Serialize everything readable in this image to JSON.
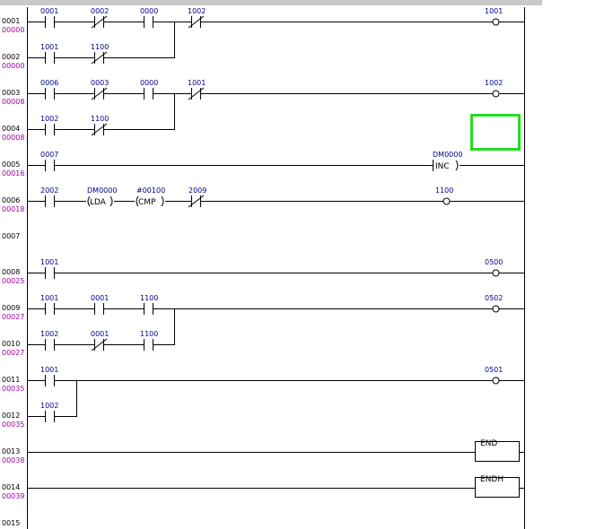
{
  "rungs": [
    {
      "num": "0001",
      "addr": "00000"
    },
    {
      "num": "0002",
      "addr": "00000"
    },
    {
      "num": "0003",
      "addr": "00008"
    },
    {
      "num": "0004",
      "addr": "00008"
    },
    {
      "num": "0005",
      "addr": "00016"
    },
    {
      "num": "0006",
      "addr": "00018"
    },
    {
      "num": "0007",
      "addr": ""
    },
    {
      "num": "0008",
      "addr": "00025"
    },
    {
      "num": "0009",
      "addr": "00027"
    },
    {
      "num": "0010",
      "addr": "00027"
    },
    {
      "num": "0011",
      "addr": "00035"
    },
    {
      "num": "0012",
      "addr": "00035"
    },
    {
      "num": "0013",
      "addr": "00038"
    },
    {
      "num": "0014",
      "addr": "00039"
    },
    {
      "num": "0015",
      "addr": ""
    }
  ],
  "elements": {
    "r1": {
      "c1": "0001",
      "c2": "0002",
      "c3": "0000",
      "c4": "1002",
      "coil": "1001"
    },
    "r2": {
      "c1": "1001",
      "c2": "1100"
    },
    "r3": {
      "c1": "0006",
      "c2": "0003",
      "c3": "0000",
      "c4": "1001",
      "coil": "1002"
    },
    "r4": {
      "c1": "1002",
      "c2": "1100"
    },
    "r5": {
      "c1": "0007",
      "fn_operand": "DM0000",
      "fn": "INC"
    },
    "r6": {
      "c1": "2002",
      "ld_operand": "DM0000",
      "ld_fn": "LDA",
      "cmp_operand": "#00100",
      "cmp_fn": "CMP",
      "c4": "2009",
      "coil": "1100"
    },
    "r8": {
      "c1": "1001",
      "coil": "0500"
    },
    "r9": {
      "c1": "1001",
      "c2": "0001",
      "c3": "1100",
      "coil": "0502"
    },
    "r10": {
      "c1": "1002",
      "c2": "0001",
      "c3": "1100"
    },
    "r11": {
      "c1": "1001",
      "coil": "0501"
    },
    "r12": {
      "c1": "1002"
    },
    "r13": {
      "fn": "END"
    },
    "r14": {
      "fn": "ENDH"
    }
  },
  "colors": {
    "selection": "#22dd22",
    "rung_number": "#000000",
    "rung_address": "#a000a0",
    "operand": "#00008b"
  }
}
